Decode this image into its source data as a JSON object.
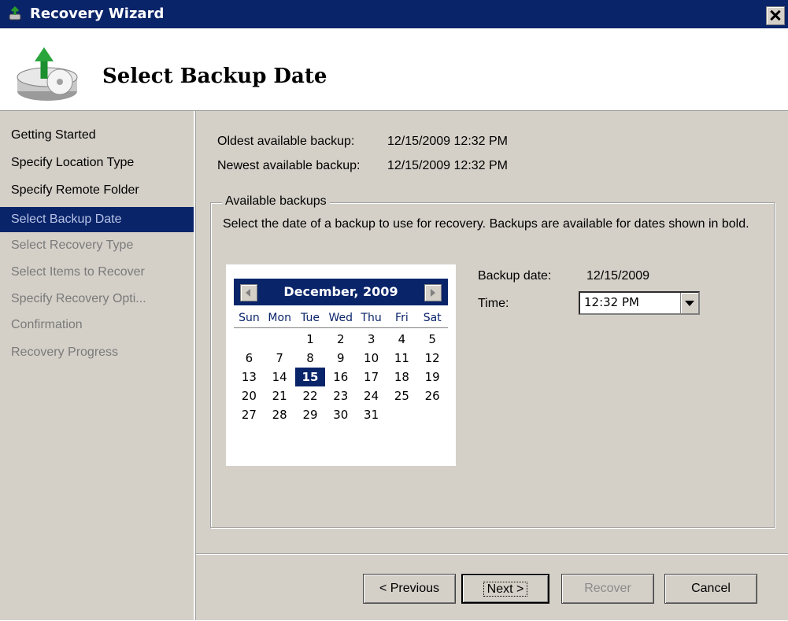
{
  "window": {
    "title": "Recovery Wizard"
  },
  "header": {
    "title": "Select Backup Date"
  },
  "nav": {
    "items": [
      {
        "label": "Getting Started",
        "state": "done"
      },
      {
        "label": "Specify Location Type",
        "state": "done"
      },
      {
        "label": "Specify Remote Folder",
        "state": "done"
      },
      {
        "label": "Select Backup Date",
        "state": "selected"
      },
      {
        "label": "Select Recovery Type",
        "state": "disabled"
      },
      {
        "label": "Select Items to Recover",
        "state": "disabled"
      },
      {
        "label": "Specify Recovery Opti...",
        "state": "disabled"
      },
      {
        "label": "Confirmation",
        "state": "disabled"
      },
      {
        "label": "Recovery Progress",
        "state": "disabled"
      }
    ]
  },
  "info": {
    "oldest_label": "Oldest available backup:",
    "oldest_value": "12/15/2009 12:32 PM",
    "newest_label": "Newest available backup:",
    "newest_value": "12/15/2009 12:32 PM"
  },
  "backups": {
    "group_label": "Available backups",
    "description": "Select the date of a backup to use for recovery. Backups are available for dates shown in bold."
  },
  "calendar": {
    "month": "December, 2009",
    "days_of_week": [
      "Sun",
      "Mon",
      "Tue",
      "Wed",
      "Thu",
      "Fri",
      "Sat"
    ],
    "weeks": [
      [
        "",
        "",
        "1",
        "2",
        "3",
        "4",
        "5"
      ],
      [
        "6",
        "7",
        "8",
        "9",
        "10",
        "11",
        "12"
      ],
      [
        "13",
        "14",
        "15",
        "16",
        "17",
        "18",
        "19"
      ],
      [
        "20",
        "21",
        "22",
        "23",
        "24",
        "25",
        "26"
      ],
      [
        "27",
        "28",
        "29",
        "30",
        "31",
        "",
        ""
      ]
    ],
    "selected_day": "15"
  },
  "selection": {
    "backup_date_label": "Backup date:",
    "backup_date_value": "12/15/2009",
    "time_label": "Time:",
    "time_value": "12:32 PM"
  },
  "buttons": {
    "previous": "< Previous",
    "next": "Next >",
    "recover": "Recover",
    "cancel": "Cancel"
  }
}
